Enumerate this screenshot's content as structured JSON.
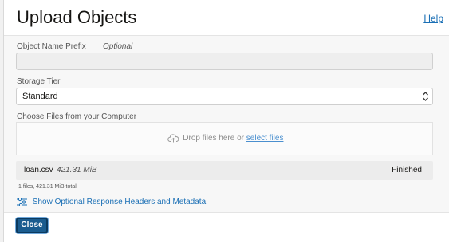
{
  "dialog": {
    "title": "Upload Objects",
    "help_label": "Help"
  },
  "form": {
    "prefix_label": "Object Name Prefix",
    "prefix_optional": "Optional",
    "prefix_value": "",
    "storage_tier_label": "Storage Tier",
    "storage_tier_value": "Standard",
    "choose_files_label": "Choose Files from your Computer",
    "drop_text": "Drop files here or",
    "select_files_link": "select files"
  },
  "files": [
    {
      "name": "loan.csv",
      "size": "421.31 MiB",
      "status": "Finished"
    }
  ],
  "summary": "1 files, 421.31 MiB total",
  "toggle_headers_label": "Show Optional Response Headers and Metadata",
  "footer": {
    "close_label": "Close"
  },
  "colors": {
    "link": "#1a6fb5",
    "button": "#1a5c8f"
  }
}
